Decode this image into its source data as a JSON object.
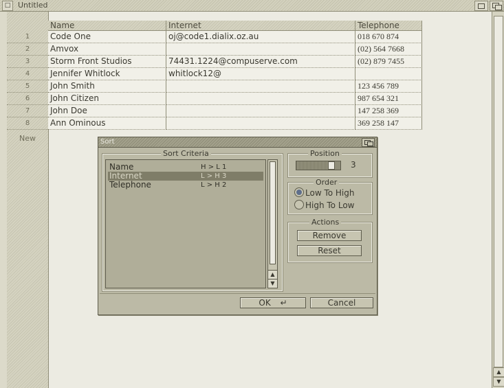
{
  "window": {
    "close_glyph": "□",
    "title": "Untitled"
  },
  "table": {
    "columns": [
      "Name",
      "Internet",
      "Telephone"
    ],
    "rows": [
      {
        "num": "1",
        "name": "Code One",
        "internet": "oj@code1.dialix.oz.au",
        "telephone": "018 670 874"
      },
      {
        "num": "2",
        "name": "Amvox",
        "internet": "",
        "telephone": "(02) 564 7668"
      },
      {
        "num": "3",
        "name": "Storm Front Studios",
        "internet": "74431.1224@compuserve.com",
        "telephone": "(02) 879 7455"
      },
      {
        "num": "4",
        "name": "Jennifer Whitlock",
        "internet": "whitlock12@",
        "telephone": ""
      },
      {
        "num": "5",
        "name": "John Smith",
        "internet": "",
        "telephone": "123 456 789"
      },
      {
        "num": "6",
        "name": "John Citizen",
        "internet": "",
        "telephone": "987 654 321"
      },
      {
        "num": "7",
        "name": "John Doe",
        "internet": "",
        "telephone": "147 258 369"
      },
      {
        "num": "8",
        "name": "Ann Ominous",
        "internet": "",
        "telephone": "369 258 147"
      }
    ],
    "new_row_label": "New"
  },
  "sort_dialog": {
    "title": "Sort",
    "criteria_group_label": "Sort Criteria",
    "criteria": [
      {
        "field": "Name",
        "rule": "H > L  1"
      },
      {
        "field": "Internet",
        "rule": "L > H  3"
      },
      {
        "field": "Telephone",
        "rule": "L > H  2"
      }
    ],
    "selected_index": 1,
    "position_group_label": "Position",
    "position_value": "3",
    "position_fraction": 0.85,
    "order_group_label": "Order",
    "order_options": [
      "Low To High",
      "High To Low"
    ],
    "order_selected": "Low To High",
    "actions_group_label": "Actions",
    "remove_label": "Remove",
    "reset_label": "Reset",
    "ok_label": "OK",
    "enter_glyph": "↵",
    "cancel_label": "Cancel"
  },
  "icons": {
    "close": "close-icon",
    "zoom": "zoom-icon",
    "depth": "depth-icon",
    "scroll_up": "▲",
    "scroll_down": "▼"
  }
}
